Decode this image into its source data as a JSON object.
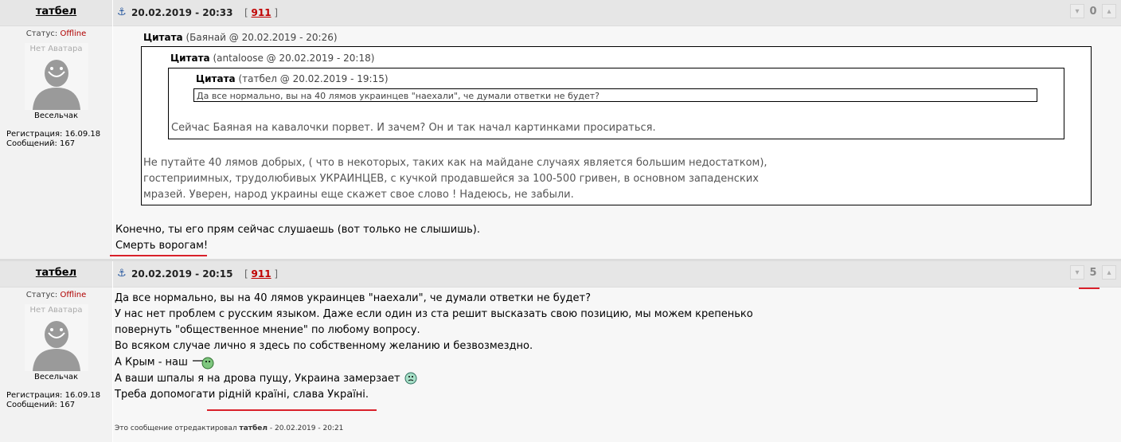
{
  "posts": [
    {
      "author": "татбел",
      "status_label": "Статус:",
      "status_value": "Offline",
      "avatar_text": "Нет Аватара",
      "rank": "Весельчак",
      "registration": "Регистрация: 16.09.18",
      "messages": "Сообщений: 167",
      "date": "20.02.2019 - 20:33",
      "ref_open": "[",
      "ref_link": "911",
      "ref_close": "]",
      "vote_count": "0",
      "quote1": {
        "label": "Цитата",
        "source": "(Баянай @ 20.02.2019 - 20:26)",
        "text": [
          "Не путайте 40 лямов добрых, ( что в некоторых, таких как на майдане случаях является большим недостатком),",
          "гостеприимных, трудолюбивых УКРАИНЦЕВ, с кучкой продавшейся за 100-500 гривен, в основном западенских",
          "мразей. Уверен, народ украины еще скажет свое слово ! Надеюсь, не забыли."
        ]
      },
      "quote2": {
        "label": "Цитата",
        "source": "(antaloose @ 20.02.2019 - 20:18)",
        "text": "Сейчас Баяная на кавалочки порвет. И зачем? Он и так начал картинками просираться."
      },
      "quote3": {
        "label": "Цитата",
        "source": "(татбел @ 20.02.2019 - 19:15)",
        "text": "Да все нормально, вы на 40 лямов украинцев \"наехали\", че думали ответки не будет?"
      },
      "body": [
        "Конечно, ты его прям сейчас слушаешь (вот только не слышишь).",
        "Смерть ворогам!"
      ]
    },
    {
      "author": "татбел",
      "status_label": "Статус:",
      "status_value": "Offline",
      "avatar_text": "Нет Аватара",
      "rank": "Весельчак",
      "registration": "Регистрация: 16.09.18",
      "messages": "Сообщений: 167",
      "date": "20.02.2019 - 20:15",
      "ref_open": "[",
      "ref_link": "911",
      "ref_close": "]",
      "vote_count": "5",
      "body": [
        "Да все нормально, вы на 40 лямов украинцев \"наехали\", че думали ответки не будет?",
        "У нас нет проблем с русским языком. Даже если один из ста решит высказать свою позицию, мы можем крепенько",
        "повернуть \"общественное мнение\" по любому вопросу.",
        "Во всяком случае лично я здесь по собственному желанию и безвозмездно.",
        "А Крым - наш",
        "А ваши шпалы я на дрова пущу, Украина замерзает",
        "Треба допомогати рідній країні, слава Україні."
      ],
      "edit_prefix": "Это сообщение отредактировал",
      "edit_author": "татбел",
      "edit_date": "- 20.02.2019 - 20:21"
    }
  ],
  "icons": {
    "anchor": "anchor-icon",
    "vote_down": "thumb-down-icon",
    "vote_up": "thumb-up-icon",
    "smiley1": "crimea-smiley-icon",
    "smiley2": "frozen-smiley-icon"
  },
  "colors": {
    "offline": "#b00000",
    "link_red": "#c00000",
    "underline_red": "#d9202a",
    "header_bg": "#e6e6e6"
  }
}
